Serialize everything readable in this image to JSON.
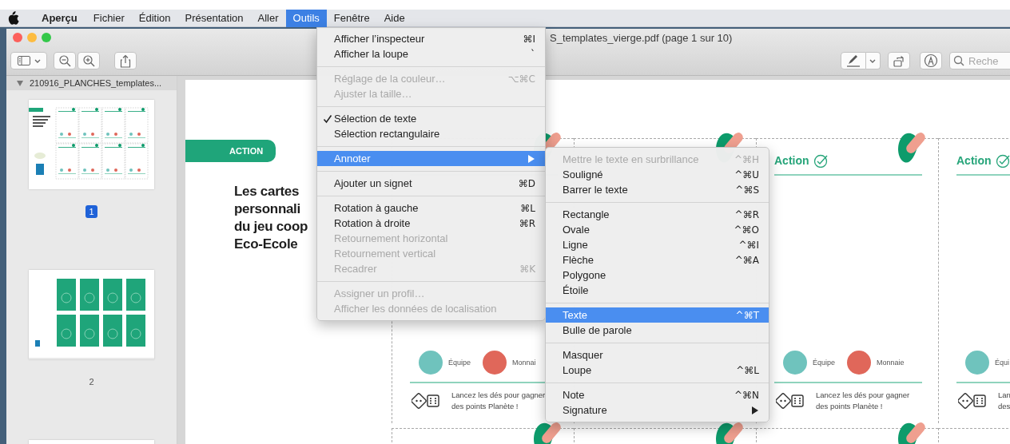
{
  "menubar": {
    "items": [
      {
        "label": "Aperçu",
        "kind": "app",
        "selected": false
      },
      {
        "label": "Fichier",
        "kind": "menu",
        "selected": false
      },
      {
        "label": "Édition",
        "kind": "menu",
        "selected": false
      },
      {
        "label": "Présentation",
        "kind": "menu",
        "selected": false
      },
      {
        "label": "Aller",
        "kind": "menu",
        "selected": false
      },
      {
        "label": "Outils",
        "kind": "menu",
        "selected": true
      },
      {
        "label": "Fenêtre",
        "kind": "menu",
        "selected": false
      },
      {
        "label": "Aide",
        "kind": "menu",
        "selected": false
      }
    ]
  },
  "window": {
    "title": "S_templates_vierge.pdf (page 1 sur 10)"
  },
  "toolbar": {
    "search": {
      "placeholder": "Reche"
    }
  },
  "sidebar": {
    "header": "210916_PLANCHES_templates...",
    "expanded": true,
    "pages": [
      {
        "label": "1",
        "selected": true,
        "kind": "cards-sheet"
      },
      {
        "label": "2",
        "selected": false,
        "kind": "green-sheet"
      },
      {
        "selected": false,
        "kind": "blank-sheet"
      }
    ]
  },
  "document": {
    "badge": "ACTION",
    "heading_lines": [
      "Les cartes",
      "personnali",
      "du jeu coop",
      "Eco-Ecole"
    ],
    "cards": [
      {
        "kind": "front",
        "team_label": "Équipe",
        "money_label": "Monnai",
        "hint_lines": [
          "Lancez les dés pour gagner",
          "des points Planète !"
        ]
      },
      {
        "kind": "covered"
      },
      {
        "kind": "front",
        "title": "Action",
        "team_label": "Équipe",
        "money_label": "Monnaie",
        "hint_lines": [
          "Lancez les dés pour gagner",
          "des points Planète !"
        ]
      },
      {
        "kind": "front",
        "title": "Action",
        "team_label": "Équi",
        "hint_lines": [
          "Lan",
          "des"
        ]
      }
    ]
  },
  "tools_menu": {
    "sections": [
      [
        {
          "label": "Afficher l’inspecteur",
          "shortcut": "⌘I",
          "disabled": false,
          "checked": false,
          "selected": false,
          "submenu": false
        },
        {
          "label": "Afficher la loupe",
          "shortcut": "`",
          "disabled": false,
          "checked": false,
          "selected": false,
          "submenu": false
        }
      ],
      [
        {
          "label": "Réglage de la couleur…",
          "shortcut": "⌥⌘C",
          "disabled": true,
          "checked": false,
          "selected": false,
          "submenu": false
        },
        {
          "label": "Ajuster la taille…",
          "disabled": true,
          "checked": false,
          "selected": false,
          "submenu": false
        }
      ],
      [
        {
          "label": "Sélection de texte",
          "disabled": false,
          "checked": true,
          "selected": false,
          "submenu": false
        },
        {
          "label": "Sélection rectangulaire",
          "disabled": false,
          "checked": false,
          "selected": false,
          "submenu": false
        }
      ],
      [
        {
          "label": "Annoter",
          "disabled": false,
          "checked": false,
          "selected": true,
          "submenu": true
        }
      ],
      [
        {
          "label": "Ajouter un signet",
          "shortcut": "⌘D",
          "disabled": false,
          "checked": false,
          "selected": false,
          "submenu": false
        }
      ],
      [
        {
          "label": "Rotation à gauche",
          "shortcut": "⌘L",
          "disabled": false,
          "checked": false,
          "selected": false,
          "submenu": false
        },
        {
          "label": "Rotation à droite",
          "shortcut": "⌘R",
          "disabled": false,
          "checked": false,
          "selected": false,
          "submenu": false
        },
        {
          "label": "Retournement horizontal",
          "disabled": true,
          "checked": false,
          "selected": false,
          "submenu": false
        },
        {
          "label": "Retournement vertical",
          "disabled": true,
          "checked": false,
          "selected": false,
          "submenu": false
        },
        {
          "label": "Recadrer",
          "shortcut": "⌘K",
          "disabled": true,
          "checked": false,
          "selected": false,
          "submenu": false
        }
      ],
      [
        {
          "label": "Assigner un profil…",
          "disabled": true,
          "checked": false,
          "selected": false,
          "submenu": false
        },
        {
          "label": "Afficher les données de localisation",
          "disabled": true,
          "checked": false,
          "selected": false,
          "submenu": false
        }
      ]
    ]
  },
  "annotate_submenu": {
    "sections": [
      [
        {
          "label": "Mettre le texte en surbrillance",
          "shortcut": "^⌘H",
          "disabled": true,
          "selected": false,
          "submenu": false
        },
        {
          "label": "Souligné",
          "shortcut": "^⌘U",
          "disabled": false,
          "selected": false,
          "submenu": false
        },
        {
          "label": "Barrer le texte",
          "shortcut": "^⌘S",
          "disabled": false,
          "selected": false,
          "submenu": false
        }
      ],
      [
        {
          "label": "Rectangle",
          "shortcut": "^⌘R",
          "disabled": false,
          "selected": false,
          "submenu": false
        },
        {
          "label": "Ovale",
          "shortcut": "^⌘O",
          "disabled": false,
          "selected": false,
          "submenu": false
        },
        {
          "label": "Ligne",
          "shortcut": "^⌘I",
          "disabled": false,
          "selected": false,
          "submenu": false
        },
        {
          "label": "Flèche",
          "shortcut": "^⌘A",
          "disabled": false,
          "selected": false,
          "submenu": false
        },
        {
          "label": "Polygone",
          "disabled": false,
          "selected": false,
          "submenu": false
        },
        {
          "label": "Étoile",
          "disabled": false,
          "selected": false,
          "submenu": false
        }
      ],
      [
        {
          "label": "Texte",
          "shortcut": "^⌘T",
          "disabled": false,
          "selected": true,
          "submenu": false
        },
        {
          "label": "Bulle de parole",
          "disabled": false,
          "selected": false,
          "submenu": false
        }
      ],
      [
        {
          "label": "Masquer",
          "disabled": false,
          "selected": false,
          "submenu": false
        },
        {
          "label": "Loupe",
          "shortcut": "^⌘L",
          "disabled": false,
          "selected": false,
          "submenu": false
        }
      ],
      [
        {
          "label": "Note",
          "shortcut": "^⌘N",
          "disabled": false,
          "selected": false,
          "submenu": false
        },
        {
          "label": "Signature",
          "disabled": false,
          "selected": false,
          "submenu": true
        }
      ]
    ]
  }
}
